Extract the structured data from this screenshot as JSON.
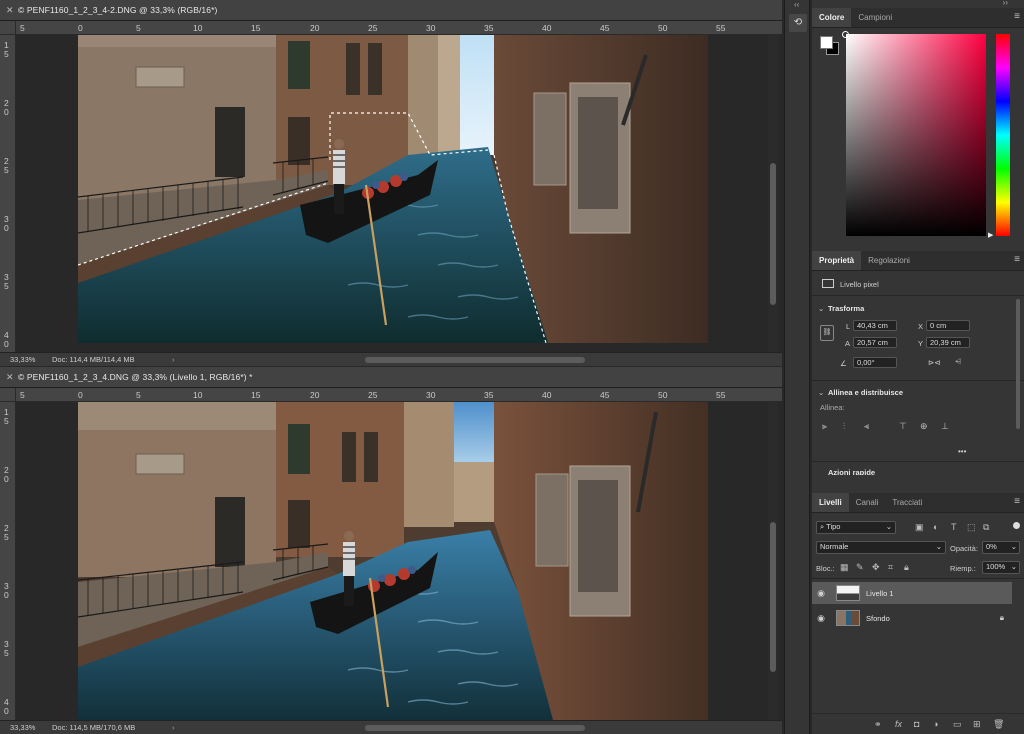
{
  "doc_top": {
    "title": "© PENF1160_1_2_3_4-2.DNG @ 33,3% (RGB/16*)",
    "zoom": "33,33%",
    "doc_info": "Doc: 114,4 MB/114,4 MB",
    "ruler_h": [
      "5",
      "0",
      "5",
      "10",
      "15",
      "20",
      "25",
      "30",
      "35",
      "40",
      "45",
      "50",
      "55"
    ],
    "ruler_v": [
      "1 5",
      "2 0",
      "2 5",
      "3 0",
      "3 5",
      "4 0"
    ]
  },
  "doc_bottom": {
    "title": "© PENF1160_1_2_3_4.DNG @ 33,3% (Livello 1, RGB/16*) *",
    "zoom": "33,33%",
    "doc_info": "Doc: 114,5 MB/170,6 MB",
    "ruler_h": [
      "5",
      "0",
      "5",
      "10",
      "15",
      "20",
      "25",
      "30",
      "35",
      "40",
      "45",
      "50",
      "55"
    ],
    "ruler_v": [
      "1 5",
      "2 0",
      "2 5",
      "3 0",
      "3 5",
      "4 0"
    ]
  },
  "color_panel": {
    "tabs": [
      "Colore",
      "Campioni"
    ],
    "fg_color": "#ffffff",
    "bg_color": "#000000",
    "picker_hue": "#ff0040"
  },
  "properties": {
    "tabs": [
      "Proprietà",
      "Regolazioni"
    ],
    "kind": "Livello pixel",
    "transform_title": "Trasforma",
    "L_label": "L",
    "L": "40,43 cm",
    "A_label": "A",
    "A": "20,57 cm",
    "X_label": "X",
    "X": "0 cm",
    "Y_label": "Y",
    "Y": "20,39 cm",
    "angle": "0,00°",
    "align_title": "Allinea e distribuisce",
    "align_label": "Allinea:",
    "more": "•••",
    "quick_actions": "Azioni rapide"
  },
  "layers": {
    "tabs": [
      "Livelli",
      "Canali",
      "Tracciati"
    ],
    "filter": "Tipo",
    "blend_mode": "Normale",
    "opacity_label": "Opacità:",
    "opacity": "0%",
    "lock_label": "Bloc.:",
    "fill_label": "Riemp.:",
    "fill": "100%",
    "items": [
      {
        "name": "Livello 1",
        "selected": true
      },
      {
        "name": "Sfondo",
        "selected": false
      }
    ],
    "footer_icons": [
      "link-icon",
      "fx-icon",
      "mask-icon",
      "adjustment-icon",
      "folder-icon",
      "new-layer-icon",
      "trash-icon"
    ]
  }
}
